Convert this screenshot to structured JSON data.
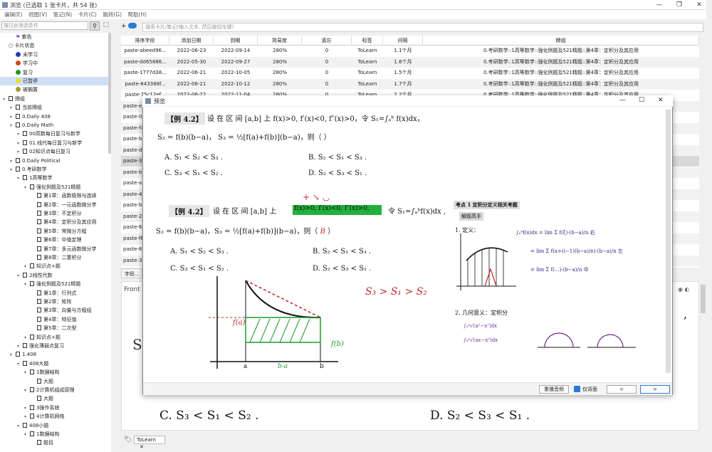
{
  "window": {
    "title": "浏览 (已选取 1 张卡片，共 54 张)"
  },
  "menu": [
    "编辑(E)",
    "视图(V)",
    "笔记(N)",
    "卡片(C)",
    "跳转(G)",
    "帮助(H)"
  ],
  "left_search": {
    "placeholder": "搜过此筛选条件"
  },
  "tree": {
    "items": [
      {
        "label": "紫色",
        "indent": 1,
        "icon": "flag"
      },
      {
        "label": "卡片状态",
        "indent": 0,
        "icon": "circle"
      },
      {
        "label": "未学习",
        "indent": 1,
        "icon": "dot",
        "color": "#2a3bb5"
      },
      {
        "label": "学习中",
        "indent": 1,
        "icon": "dot",
        "color": "#d9441c"
      },
      {
        "label": "复习",
        "indent": 1,
        "icon": "dot",
        "color": "#1a9a28"
      },
      {
        "label": "已暂停",
        "indent": 1,
        "icon": "dot",
        "color": "#e8e020",
        "selected": true
      },
      {
        "label": "被搁置",
        "indent": 1,
        "icon": "dot",
        "color": "#a39a3c"
      },
      {
        "label": "牌组",
        "indent": 0,
        "icon": "deck"
      },
      {
        "label": "当前牌组",
        "indent": 1,
        "icon": "deck"
      },
      {
        "label": "0.Daily 408",
        "indent": 1,
        "icon": "deck"
      },
      {
        "label": "0.Daily Math",
        "indent": 1,
        "icon": "deck"
      },
      {
        "label": "00高数每日复习与新学",
        "indent": 2,
        "icon": "deck"
      },
      {
        "label": "01.线代每日复习与新学",
        "indent": 2,
        "icon": "deck"
      },
      {
        "label": "02知识点每日复习",
        "indent": 2,
        "icon": "deck"
      },
      {
        "label": "0.Daily Political",
        "indent": 1,
        "icon": "deck"
      },
      {
        "label": "0.考研数学",
        "indent": 1,
        "icon": "deck"
      },
      {
        "label": "1高等数学",
        "indent": 2,
        "icon": "deck"
      },
      {
        "label": "强化例题及521精题",
        "indent": 3,
        "icon": "deck"
      },
      {
        "label": "第1章：函数极限与连续",
        "indent": 4,
        "icon": "deck"
      },
      {
        "label": "第2章：一元函数微分学",
        "indent": 4,
        "icon": "deck"
      },
      {
        "label": "第3章：不定积分",
        "indent": 4,
        "icon": "deck"
      },
      {
        "label": "第4章：定积分及其应用",
        "indent": 4,
        "icon": "deck"
      },
      {
        "label": "第5章：常微分方程",
        "indent": 4,
        "icon": "deck"
      },
      {
        "label": "第6章：中值定理",
        "indent": 4,
        "icon": "deck"
      },
      {
        "label": "第7章：多元函数微分学",
        "indent": 4,
        "icon": "deck"
      },
      {
        "label": "第8章：二重积分",
        "indent": 4,
        "icon": "deck"
      },
      {
        "label": "知识点+题",
        "indent": 3,
        "icon": "deck"
      },
      {
        "label": "2线性代数",
        "indent": 2,
        "icon": "deck"
      },
      {
        "label": "强化例题及521精题",
        "indent": 3,
        "icon": "deck"
      },
      {
        "label": "第1章：行列式",
        "indent": 4,
        "icon": "deck"
      },
      {
        "label": "第2章：矩阵",
        "indent": 4,
        "icon": "deck"
      },
      {
        "label": "第3章：向量与方程组",
        "indent": 4,
        "icon": "deck"
      },
      {
        "label": "第4章：特征值",
        "indent": 4,
        "icon": "deck"
      },
      {
        "label": "第5章：二次型",
        "indent": 4,
        "icon": "deck"
      },
      {
        "label": "知识点+题",
        "indent": 3,
        "icon": "deck"
      },
      {
        "label": "强化薄弱点复习",
        "indent": 2,
        "icon": "deck"
      },
      {
        "label": "1.408",
        "indent": 1,
        "icon": "deck"
      },
      {
        "label": "408大题",
        "indent": 2,
        "icon": "deck"
      },
      {
        "label": "1数据结构",
        "indent": 3,
        "icon": "deck"
      },
      {
        "label": "大题",
        "indent": 4,
        "icon": "deck"
      },
      {
        "label": "2计算机组成原理",
        "indent": 3,
        "icon": "deck"
      },
      {
        "label": "大题",
        "indent": 4,
        "icon": "deck"
      },
      {
        "label": "3操作系统",
        "indent": 3,
        "icon": "deck"
      },
      {
        "label": "4计算机网络",
        "indent": 3,
        "icon": "deck"
      },
      {
        "label": "408小题",
        "indent": 2,
        "icon": "deck"
      },
      {
        "label": "1数据结构",
        "indent": 3,
        "icon": "deck"
      },
      {
        "label": "题目",
        "indent": 4,
        "icon": "deck"
      }
    ]
  },
  "main_search": {
    "placeholder": "搜索卡片/笔记(输入文本, 然后按回车键)"
  },
  "table": {
    "headers": [
      "排序字段",
      "添加日期",
      "到期",
      "简易度",
      "遗忘",
      "标签",
      "间隔",
      "牌组"
    ],
    "rows": [
      [
        "paste-abeed96...",
        "2022-06-23",
        "2022-09-14",
        "280%",
        "0",
        "ToLearn",
        "1.1个月",
        "0.考研数学::1高等数学::强化例题及521精题::第4章：定积分及其应用"
      ],
      [
        "paste-dd65886...",
        "2022-05-30",
        "2022-09-27",
        "280%",
        "0",
        "ToLearn",
        "1.6个月",
        "0.考研数学::1高等数学::强化例题及521精题::第4章：定积分及其应用"
      ],
      [
        "paste-1777d38...",
        "2022-06-21",
        "2022-10-05",
        "280%",
        "0",
        "ToLearn",
        "1.5个月",
        "0.考研数学::1高等数学::强化例题及521精题::第4章：定积分及其应用"
      ],
      [
        "paste-843388f...",
        "2022-06-21",
        "2022-10-12",
        "280%",
        "0",
        "ToLearn",
        "1.7个月",
        "0.考研数学::1高等数学::强化例题及521精题::第4章：定积分及其应用"
      ],
      [
        "paste-75c12ef...",
        "2022-06-22",
        "2022-11-04",
        "280%",
        "0",
        "ToLearn",
        "2.2个月",
        "0.考研数学::1高等数学::强化例题及521精题::第4章：定积分及其应用"
      ]
    ],
    "partial_rows": [
      "paste-e",
      "paste-0",
      "paste-f4",
      "paste-b",
      "paste-d6",
      "paste-3",
      "paste-b",
      "paste-a",
      "paste-4",
      "paste-b",
      "paste-2",
      "paste-6",
      "paste-f6",
      "paste-8",
      "paste-3"
    ]
  },
  "fields_tab": "字段...",
  "editor": {
    "label": "Front"
  },
  "tag_chip": "ToLearn",
  "preview": {
    "title": "预览",
    "example_label": "【例 4.2】",
    "q_text": "设 在 区 间 [a,b] 上  f(x)>0, f′(x)<0, f″(x)>0，令  S₁=∫ₐᵇ f(x)dx，",
    "q_line2": "S₂ = f(b)(b−a)，  S₃ = ½[f(a)+f(b)](b−a)，则（      ）",
    "choices": [
      "A.   S₁ < S₂ < S₃ .",
      "B.   S₂ < S₁ < S₃ .",
      "C.   S₃ < S₁ < S₂ .",
      "D.   S₂ < S₃ < S₁ ."
    ],
    "answer": "B",
    "handwritten": "S₃ > S₁ > S₂",
    "fa_label": "f(a)",
    "fb_label": "f(b)",
    "ba_label": "b-a",
    "axis_a": "a",
    "axis_b": "b",
    "right_title": "考点 1   定积分定义相关考题",
    "right_sub": "解题高手",
    "right_lines": [
      "1. 定义：",
      "∫ₐᵇf(x)dx = lim Σ f(ξ)·(b−a)/n  右",
      "= lim Σ f(a+(i−1)(b−a)/n)·(b−a)/n  左",
      "= lim Σ f(...)·(b−a)/n  中",
      "2. 几何意义：定积分",
      "∫₀ᵃ√(a²−x²)dx",
      "∫₀ᵃ√(ax−x²)dx"
    ],
    "bottom_buttons": {
      "replay": "重播音频",
      "back_only": "仅背面",
      "prev": "<",
      "next": ">"
    }
  },
  "behind_choices": {
    "c": "C.   S₃ < S₁ < S₂ .",
    "d": "D.   S₂ < S₃ < S₁ ."
  },
  "colors": {
    "accent": "#2a7bd3",
    "selected": "#cfe0f5",
    "highlight_green": "#22b03a",
    "hand_red": "#c0282c"
  }
}
